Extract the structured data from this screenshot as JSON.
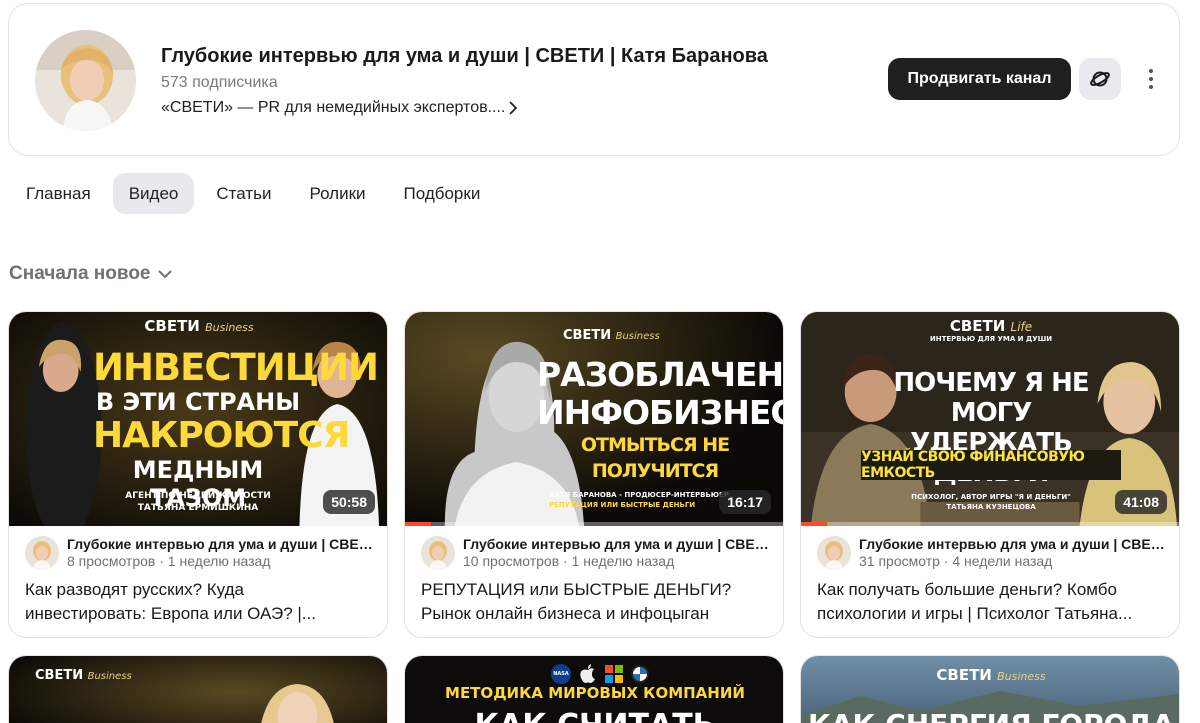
{
  "channel": {
    "title": "Глубокие интервью для ума и души | СВЕТИ | Катя Баранова",
    "subscribers": "573 подписчика",
    "description": "«СВЕТИ» — PR для немедийных экспертов....",
    "promote_label": "Продвигать канал"
  },
  "tabs": [
    {
      "label": "Главная",
      "active": false
    },
    {
      "label": "Видео",
      "active": true
    },
    {
      "label": "Статьи",
      "active": false
    },
    {
      "label": "Ролики",
      "active": false
    },
    {
      "label": "Подборки",
      "active": false
    }
  ],
  "sort_label": "Сначала новое",
  "videos": [
    {
      "brand": "СВЕТИ",
      "brand_script": "Business",
      "thumb_lines": [
        "ИНВЕСТИЦИИ",
        "В ЭТИ СТРАНЫ",
        "НАКРОЮТСЯ",
        "МЕДНЫМ ТАЗОМ"
      ],
      "thumb_caption": [
        "АГЕНТ ПО НЕДВИЖИМОСТИ",
        "ТАТЬЯНА ЕРМИШКИНА"
      ],
      "duration": "50:58",
      "channel": "Глубокие интервью для ума и души | СВЕТИ | Катя Баранова",
      "stats": "8 просмотров · 1 неделю назад",
      "title_line1": "Как разводят русских? Куда",
      "title_line2": "инвестировать: Европа или ОАЭ? |..."
    },
    {
      "brand": "СВЕТИ",
      "brand_script": "Business",
      "thumb_lines": [
        "РАЗОБЛАЧЕНИЕ",
        "ИНФОБИЗНЕСА",
        "ОТМЫТЬСЯ НЕ ПОЛУЧИТСЯ"
      ],
      "thumb_caption": [
        "КАТЯ БАРАНОВА - ПРОДЮСЕР-ИНТЕРВЬЮЕР",
        "РЕПУТАЦИЯ ИЛИ БЫСТРЫЕ ДЕНЬГИ"
      ],
      "duration": "16:17",
      "progress": 0.07,
      "channel": "Глубокие интервью для ума и души | СВЕТИ | Катя Баранова",
      "stats": "10 просмотров · 1 неделю назад",
      "title_line1": "РЕПУТАЦИЯ или БЫСТРЫЕ ДЕНЬГИ?",
      "title_line2": "Рынок онлайн бизнеса и инфоцыган"
    },
    {
      "brand": "СВЕТИ",
      "brand_script": "Life",
      "brand_sub": "ИНТЕРВЬЮ ДЛЯ УМА И ДУШИ",
      "thumb_lines": [
        "ПОЧЕМУ Я НЕ МОГУ",
        "УДЕРЖАТЬ ДЕНЬГИ",
        "УЗНАЙ СВОЮ ФИНАНСОВУЮ ЕМКОСТЬ"
      ],
      "thumb_caption": [
        "ПСИХОЛОГ, АВТОР ИГРЫ \"Я И ДЕНЬГИ\"",
        "ТАТЬЯНА КУЗНЕЦОВА"
      ],
      "duration": "41:08",
      "progress": 0.07,
      "channel": "Глубокие интервью для ума и души | СВЕТИ | Катя Баранова",
      "stats": "31 просмотр · 4 недели назад",
      "title_line1": "Как получать большие деньги? Комбо",
      "title_line2": "психологии и игры | Психолог Татьяна..."
    }
  ],
  "row2": [
    {
      "brand": "СВЕТИ",
      "brand_script": "Business"
    },
    {
      "headline": "МЕТОДИКА МИРОВЫХ КОМПАНИЙ",
      "headline2": "КАК СЧИТАТЬ",
      "logo_text": "NASA"
    },
    {
      "brand": "СВЕТИ",
      "brand_script": "Business",
      "headline2": "КАК СНЕРГИЯ ГОРОДА"
    }
  ]
}
